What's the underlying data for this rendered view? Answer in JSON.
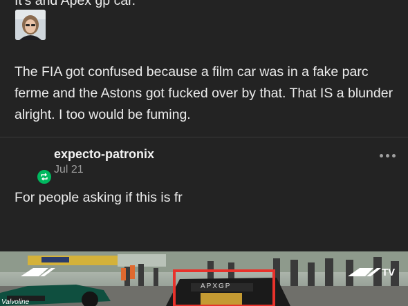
{
  "post": {
    "previous_line": "It's and Apex gp car.",
    "paragraph": "The FIA got confused because a film car was in a fake parc ferme and the Astons got fucked over by that. That IS a blunder alright. I too would be fuming."
  },
  "reblog": {
    "username": "expecto-patronix",
    "date": "Jul 21",
    "comment": "For people asking if this is fr"
  },
  "image": {
    "logo_left": "F1",
    "logo_right": "F1 TV",
    "car_text": "APXGP",
    "sponsor_text": "Valvoline"
  },
  "colors": {
    "background": "#232323",
    "text": "#ececec",
    "muted": "#9a9a9a",
    "reblog_green": "#00b85f",
    "highlight_box": "#e8322b"
  }
}
